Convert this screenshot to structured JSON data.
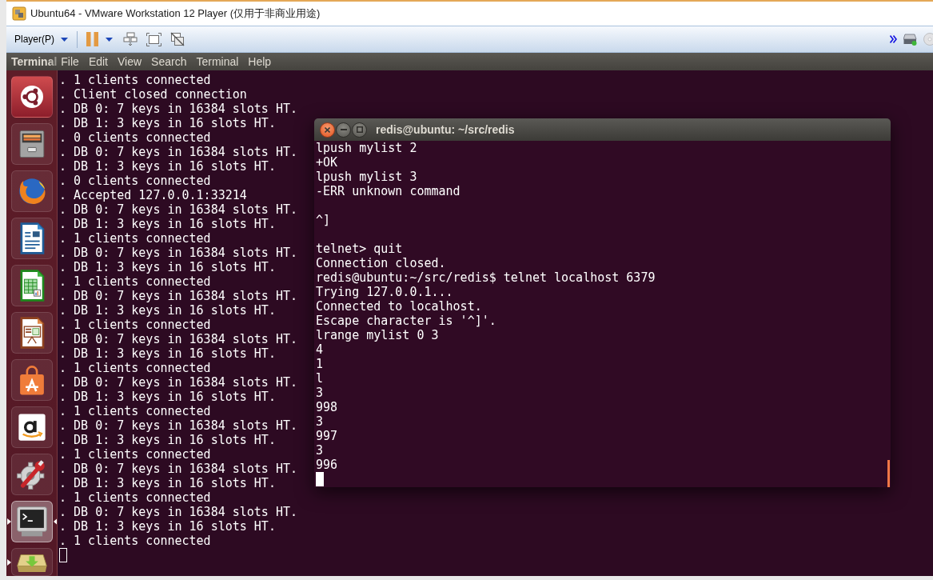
{
  "window": {
    "title": "Ubuntu64 - VMware Workstation 12 Player (仅用于非商业用途)"
  },
  "toolbar": {
    "player_menu": "Player(P)"
  },
  "panel": {
    "app_name": "Terminal",
    "menus": [
      "File",
      "Edit",
      "View",
      "Search",
      "Terminal",
      "Help"
    ]
  },
  "launcher": [
    {
      "kind": "dash",
      "running": false,
      "focused": false
    },
    {
      "kind": "files",
      "running": false,
      "focused": false
    },
    {
      "kind": "browser",
      "running": false,
      "focused": false
    },
    {
      "kind": "writer",
      "running": false,
      "focused": false
    },
    {
      "kind": "spreadsheet",
      "running": false,
      "focused": false
    },
    {
      "kind": "presentation",
      "running": false,
      "focused": false
    },
    {
      "kind": "software",
      "running": false,
      "focused": false
    },
    {
      "kind": "shopping",
      "running": false,
      "focused": false
    },
    {
      "kind": "settings",
      "running": false,
      "focused": false
    },
    {
      "kind": "terminal",
      "running": true,
      "focused": true
    },
    {
      "kind": "drive",
      "running": true,
      "focused": false
    }
  ],
  "background_terminal": {
    "focused": false,
    "lines": [
      ". 1 clients connected",
      ". Client closed connection",
      ". DB 0: 7 keys in 16384 slots HT.",
      ". DB 1: 3 keys in 16 slots HT.",
      ". 0 clients connected",
      ". DB 0: 7 keys in 16384 slots HT.",
      ". DB 1: 3 keys in 16 slots HT.",
      ". 0 clients connected",
      ". Accepted 127.0.0.1:33214",
      ". DB 0: 7 keys in 16384 slots HT.",
      ". DB 1: 3 keys in 16 slots HT.",
      ". 1 clients connected",
      ". DB 0: 7 keys in 16384 slots HT.",
      ". DB 1: 3 keys in 16 slots HT.",
      ". 1 clients connected",
      ". DB 0: 7 keys in 16384 slots HT.",
      ". DB 1: 3 keys in 16 slots HT.",
      ". 1 clients connected",
      ". DB 0: 7 keys in 16384 slots HT.",
      ". DB 1: 3 keys in 16 slots HT.",
      ". 1 clients connected",
      ". DB 0: 7 keys in 16384 slots HT.",
      ". DB 1: 3 keys in 16 slots HT.",
      ". 1 clients connected",
      ". DB 0: 7 keys in 16384 slots HT.",
      ". DB 1: 3 keys in 16 slots HT.",
      ". 1 clients connected",
      ". DB 0: 7 keys in 16384 slots HT.",
      ". DB 1: 3 keys in 16 slots HT.",
      ". 1 clients connected",
      ". DB 0: 7 keys in 16384 slots HT.",
      ". DB 1: 3 keys in 16 slots HT.",
      ". 1 clients connected"
    ]
  },
  "terminal_window": {
    "title": "redis@ubuntu: ~/src/redis",
    "focused": true,
    "lines": [
      {
        "kind": "output",
        "text": "lpush mylist 2"
      },
      {
        "kind": "output",
        "text": "+OK"
      },
      {
        "kind": "output",
        "text": "lpush mylist 3"
      },
      {
        "kind": "output",
        "text": "-ERR unknown command"
      },
      {
        "kind": "blank"
      },
      {
        "kind": "output",
        "text": "^]"
      },
      {
        "kind": "blank"
      },
      {
        "kind": "output",
        "text": "telnet> quit"
      },
      {
        "kind": "output",
        "text": "Connection closed."
      },
      {
        "kind": "output",
        "text": "redis@ubuntu:~/src/redis$ telnet localhost 6379"
      },
      {
        "kind": "output",
        "text": "Trying 127.0.0.1..."
      },
      {
        "kind": "output",
        "text": "Connected to localhost."
      },
      {
        "kind": "output",
        "text": "Escape character is '^]'."
      },
      {
        "kind": "output",
        "text": "lrange mylist 0 3"
      },
      {
        "kind": "output",
        "text": "4"
      },
      {
        "kind": "output",
        "text": "1"
      },
      {
        "kind": "output",
        "text": "l"
      },
      {
        "kind": "output",
        "text": "3"
      },
      {
        "kind": "output",
        "text": "998"
      },
      {
        "kind": "output",
        "text": "3"
      },
      {
        "kind": "output",
        "text": "997"
      },
      {
        "kind": "output",
        "text": "3"
      },
      {
        "kind": "output",
        "text": "996"
      }
    ]
  }
}
